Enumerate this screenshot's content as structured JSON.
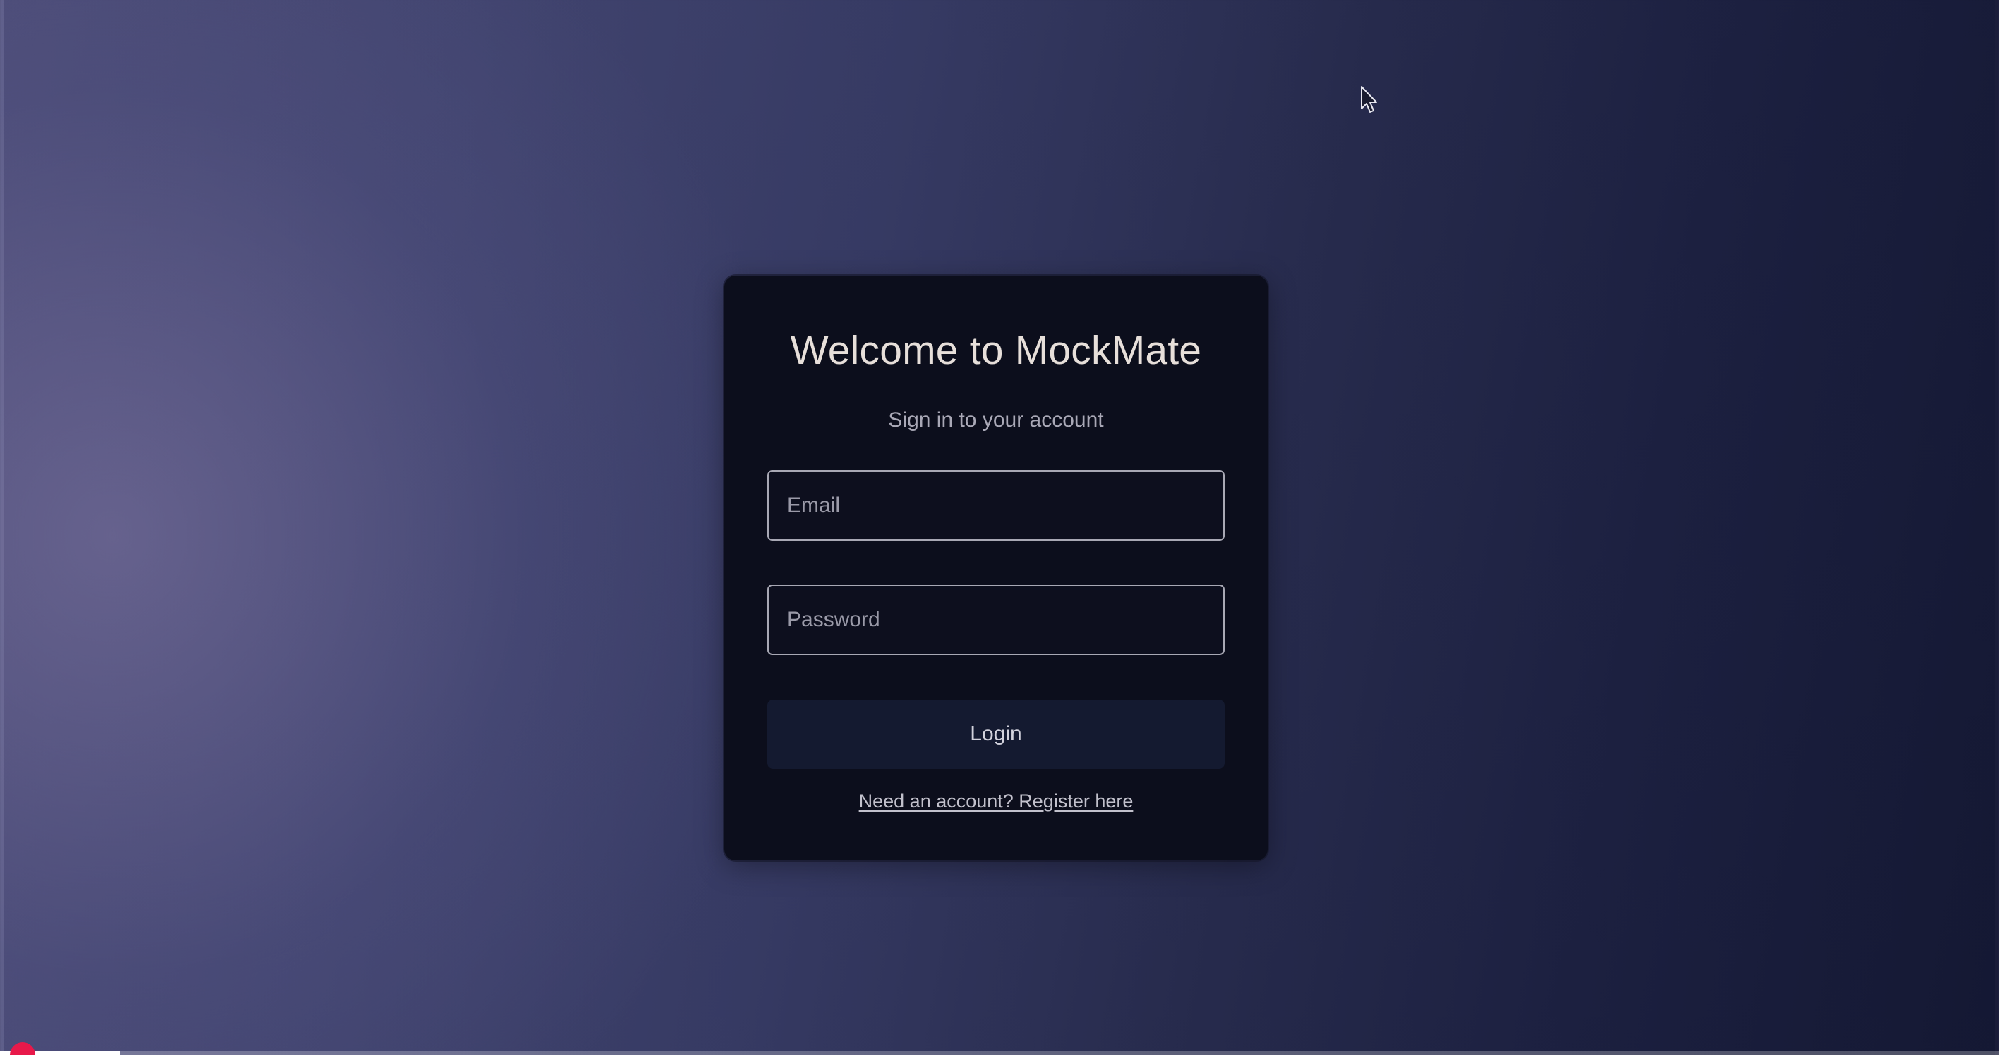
{
  "login": {
    "title": "Welcome to MockMate",
    "subtitle": "Sign in to your account",
    "email_placeholder": "Email",
    "password_placeholder": "Password",
    "login_button": "Login",
    "register_link": "Need an account? Register here"
  },
  "icons": {
    "cursor": "mouse-pointer-icon"
  },
  "video_overlay": {
    "progress_fraction": 0.06
  },
  "colors": {
    "card_background": "#0c0e1c",
    "button_background": "#141a30",
    "title_text": "#e7dfda",
    "record_indicator": "#e8194a"
  }
}
